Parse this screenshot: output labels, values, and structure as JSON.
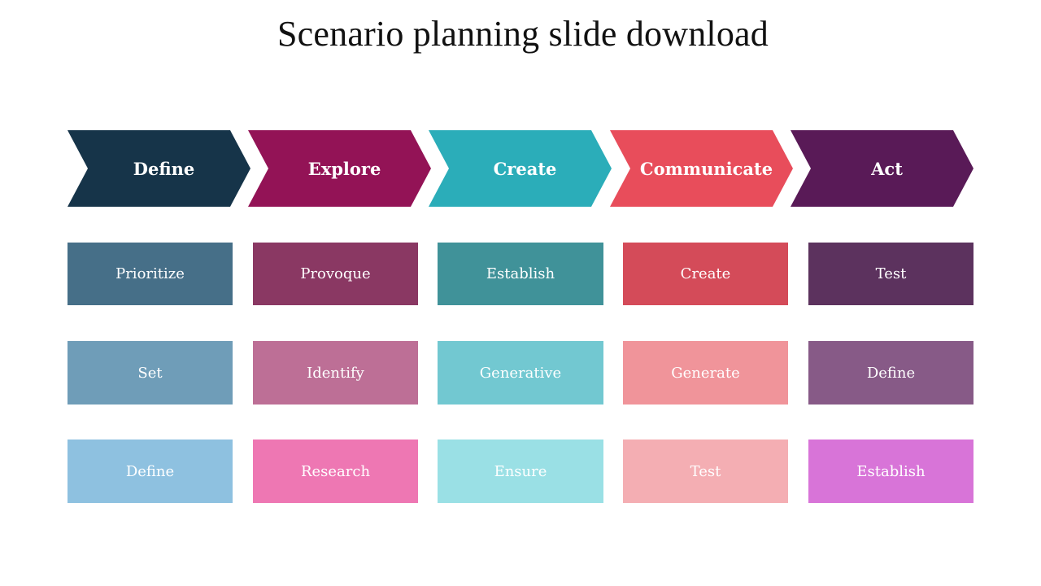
{
  "title": "Scenario planning slide download",
  "columns": [
    {
      "header": "Define",
      "header_color": "#163449",
      "items": [
        {
          "label": "Prioritize",
          "color": "#466f88"
        },
        {
          "label": "Set",
          "color": "#6f9db8"
        },
        {
          "label": "Define",
          "color": "#8ec1e0"
        }
      ]
    },
    {
      "header": "Explore",
      "header_color": "#931356",
      "items": [
        {
          "label": "Provoque",
          "color": "#8a3863"
        },
        {
          "label": "Identify",
          "color": "#bd6f96"
        },
        {
          "label": "Research",
          "color": "#ee77b3"
        }
      ]
    },
    {
      "header": "Create",
      "header_color": "#2badb9",
      "items": [
        {
          "label": "Establish",
          "color": "#409299"
        },
        {
          "label": "Generative",
          "color": "#72c8d1"
        },
        {
          "label": "Ensure",
          "color": "#9ae0e5"
        }
      ]
    },
    {
      "header": "Communicate",
      "header_color": "#e84d5b",
      "items": [
        {
          "label": "Create",
          "color": "#d44b59"
        },
        {
          "label": "Generate",
          "color": "#f0949a"
        },
        {
          "label": "Test",
          "color": "#f4aeb3"
        }
      ]
    },
    {
      "header": "Act",
      "header_color": "#591a57",
      "items": [
        {
          "label": "Test",
          "color": "#5c325e"
        },
        {
          "label": "Define",
          "color": "#875a87"
        },
        {
          "label": "Establish",
          "color": "#d874d8"
        }
      ]
    }
  ]
}
